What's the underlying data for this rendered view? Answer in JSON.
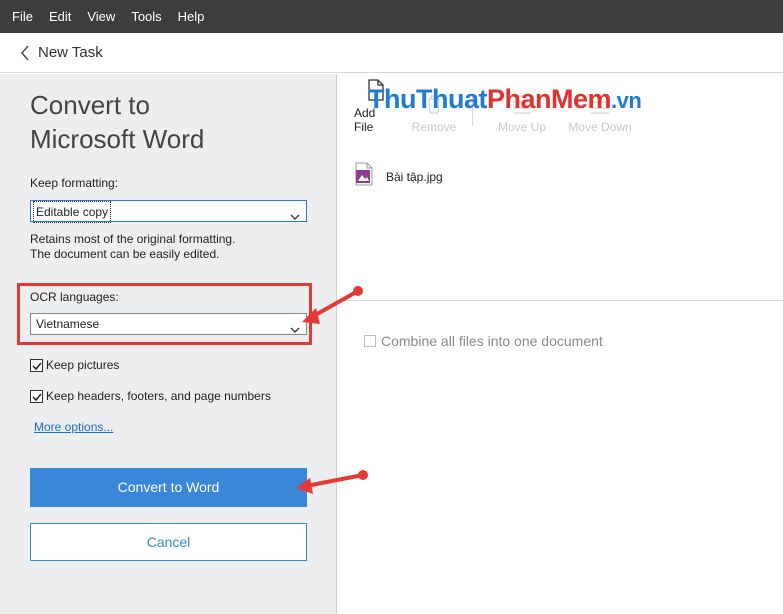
{
  "menubar": {
    "items": [
      "File",
      "Edit",
      "View",
      "Tools",
      "Help"
    ]
  },
  "nav": {
    "back_icon": "chevron-left-icon",
    "title": "New Task"
  },
  "left": {
    "heading_line1": "Convert to",
    "heading_line2": "Microsoft Word",
    "keep_formatting_label": "Keep formatting:",
    "keep_formatting_value": "Editable copy",
    "description_line1": "Retains most of the original formatting.",
    "description_line2": "The document can be easily edited.",
    "ocr_label": "OCR languages:",
    "ocr_value": "Vietnamese",
    "keep_pictures": {
      "label": "Keep pictures",
      "checked": true
    },
    "keep_headers": {
      "label": "Keep headers, footers, and page numbers",
      "checked": true
    },
    "more_options": "More options...",
    "convert_button": "Convert to Word",
    "cancel_button": "Cancel"
  },
  "toolbar": {
    "add_file": "Add File",
    "remove": "Remove",
    "move_up": "Move Up",
    "move_down": "Move Down"
  },
  "watermark": {
    "part1": "ThuThuat",
    "part2": "PhanMem",
    "part3": ".vn"
  },
  "files": [
    {
      "name": "Bài tập.jpg",
      "icon": "image-file-icon"
    }
  ],
  "combine": {
    "label": "Combine all files into one document",
    "checked": false
  },
  "colors": {
    "menubar": "#3d3d3d",
    "accent": "#3a87d8",
    "highlight": "#e53935",
    "left_panel": "#eceef0"
  }
}
